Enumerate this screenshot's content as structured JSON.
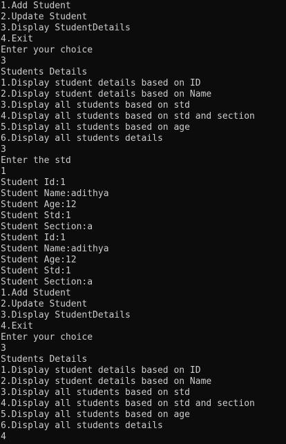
{
  "console": {
    "lines": [
      "1.Add Student",
      "2.Update Student",
      "3.Display StudentDetails",
      "4.Exit",
      "Enter your choice",
      "3",
      "Students Details",
      "1.Display student details based on ID",
      "2.Display student details based on Name",
      "3.Display all students based on std",
      "4.Display all students based on std and section",
      "5.Display all students based on age",
      "6.Display all students details",
      "3",
      "Enter the std",
      "1",
      "Student Id:1",
      "Student Name:adithya",
      "Student Age:12",
      "Student Std:1",
      "Student Section:a",
      "Student Id:1",
      "Student Name:adithya",
      "Student Age:12",
      "Student Std:1",
      "Student Section:a",
      "1.Add Student",
      "2.Update Student",
      "3.Display StudentDetails",
      "4.Exit",
      "Enter your choice",
      "3",
      "Students Details",
      "1.Display student details based on ID",
      "2.Display student details based on Name",
      "3.Display all students based on std",
      "4.Display all students based on std and section",
      "5.Display all students based on age",
      "6.Display all students details",
      "4"
    ]
  },
  "colors": {
    "background": "#0c0c0c",
    "text": "#cccccc"
  }
}
